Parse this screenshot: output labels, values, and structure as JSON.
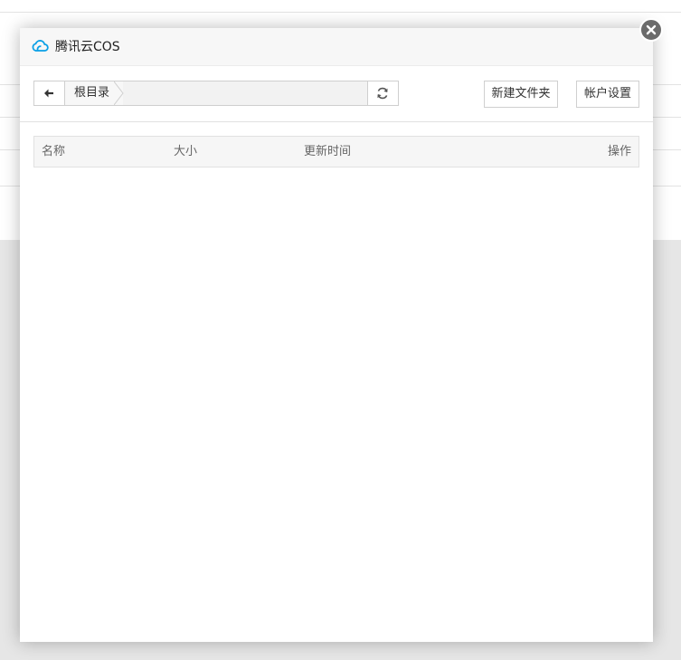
{
  "dialog": {
    "title": "腾讯云COS",
    "logo_icon": "cloud-icon",
    "close_icon": "close-icon"
  },
  "toolbar": {
    "back_icon": "arrow-left-icon",
    "breadcrumb": [
      "根目录"
    ],
    "refresh_icon": "refresh-icon",
    "new_folder_label": "新建文件夹",
    "account_settings_label": "帐户设置"
  },
  "table": {
    "columns": [
      "名称",
      "大小",
      "更新时间",
      "操作"
    ],
    "rows": []
  },
  "colors": {
    "accent": "#0aa0e6",
    "close_button": "#6b6b6b",
    "header_bg": "#f7f7f7"
  }
}
